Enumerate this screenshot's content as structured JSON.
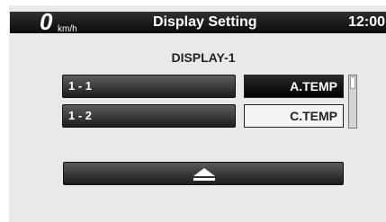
{
  "status_bar": {
    "speed": "0",
    "speed_unit": "km/h",
    "title": "Display Setting",
    "clock": "12:00"
  },
  "page_heading": "DISPLAY-1",
  "rows": [
    {
      "label": "1 - 1",
      "value": "A.TEMP",
      "selected": true
    },
    {
      "label": "1 - 2",
      "value": "C.TEMP",
      "selected": false
    }
  ],
  "back_button": {
    "icon": "eject-icon"
  },
  "colors": {
    "bar_dark": "#0a0a0a",
    "screen_bg": "#e9e9e9",
    "button_dark": "#1e1e1e"
  }
}
